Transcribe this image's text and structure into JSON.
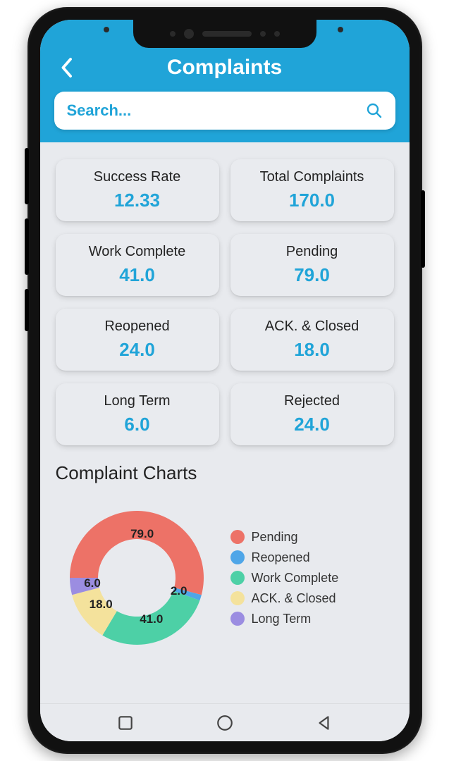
{
  "header": {
    "title": "Complaints",
    "search_placeholder": "Search..."
  },
  "accent_color": "#20a4d8",
  "cards": [
    {
      "label": "Success Rate",
      "value": "12.33"
    },
    {
      "label": "Total Complaints",
      "value": "170.0"
    },
    {
      "label": "Work Complete",
      "value": "41.0"
    },
    {
      "label": "Pending",
      "value": "79.0"
    },
    {
      "label": "Reopened",
      "value": "24.0"
    },
    {
      "label": "ACK. & Closed",
      "value": "18.0"
    },
    {
      "label": "Long Term",
      "value": "6.0"
    },
    {
      "label": "Rejected",
      "value": "24.0"
    }
  ],
  "chart_section_title": "Complaint Charts",
  "chart_data": {
    "type": "pie",
    "title": "Complaint Charts",
    "series": [
      {
        "name": "Pending",
        "value": 79.0,
        "color": "#ed7267"
      },
      {
        "name": "Reopened",
        "value": 2.0,
        "color": "#4fa6e8"
      },
      {
        "name": "Work Complete",
        "value": 41.0,
        "color": "#4dd0a6"
      },
      {
        "name": "ACK. & Closed",
        "value": 18.0,
        "color": "#f4e29c"
      },
      {
        "name": "Long Term",
        "value": 6.0,
        "color": "#9b8de1"
      }
    ],
    "legend": [
      {
        "name": "Pending",
        "color": "#ed7267"
      },
      {
        "name": "Reopened",
        "color": "#4fa6e8"
      },
      {
        "name": "Work Complete",
        "color": "#4dd0a6"
      },
      {
        "name": "ACK. & Closed",
        "color": "#f4e29c"
      },
      {
        "name": "Long Term",
        "color": "#9b8de1"
      }
    ]
  }
}
